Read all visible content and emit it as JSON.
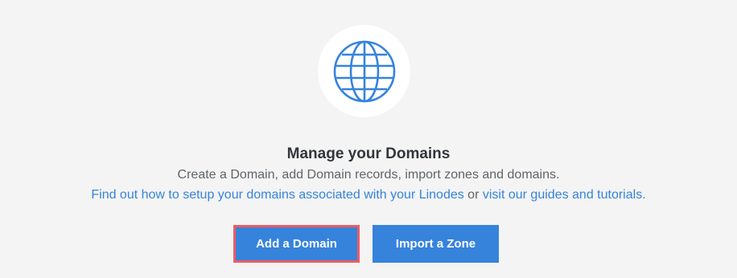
{
  "icon": {
    "name": "globe-icon",
    "color": "#3683dc"
  },
  "title": "Manage your Domains",
  "subtitle": "Create a Domain, add Domain records, import zones and domains.",
  "links": {
    "link1": "Find out how to setup your domains associated with your Linodes",
    "separator": " or ",
    "link2": "visit our guides and tutorials."
  },
  "buttons": {
    "add": "Add a Domain",
    "import": "Import a Zone"
  },
  "colors": {
    "accent": "#3683dc",
    "highlight_border": "#ef5b61",
    "background": "#f4f4f4"
  }
}
